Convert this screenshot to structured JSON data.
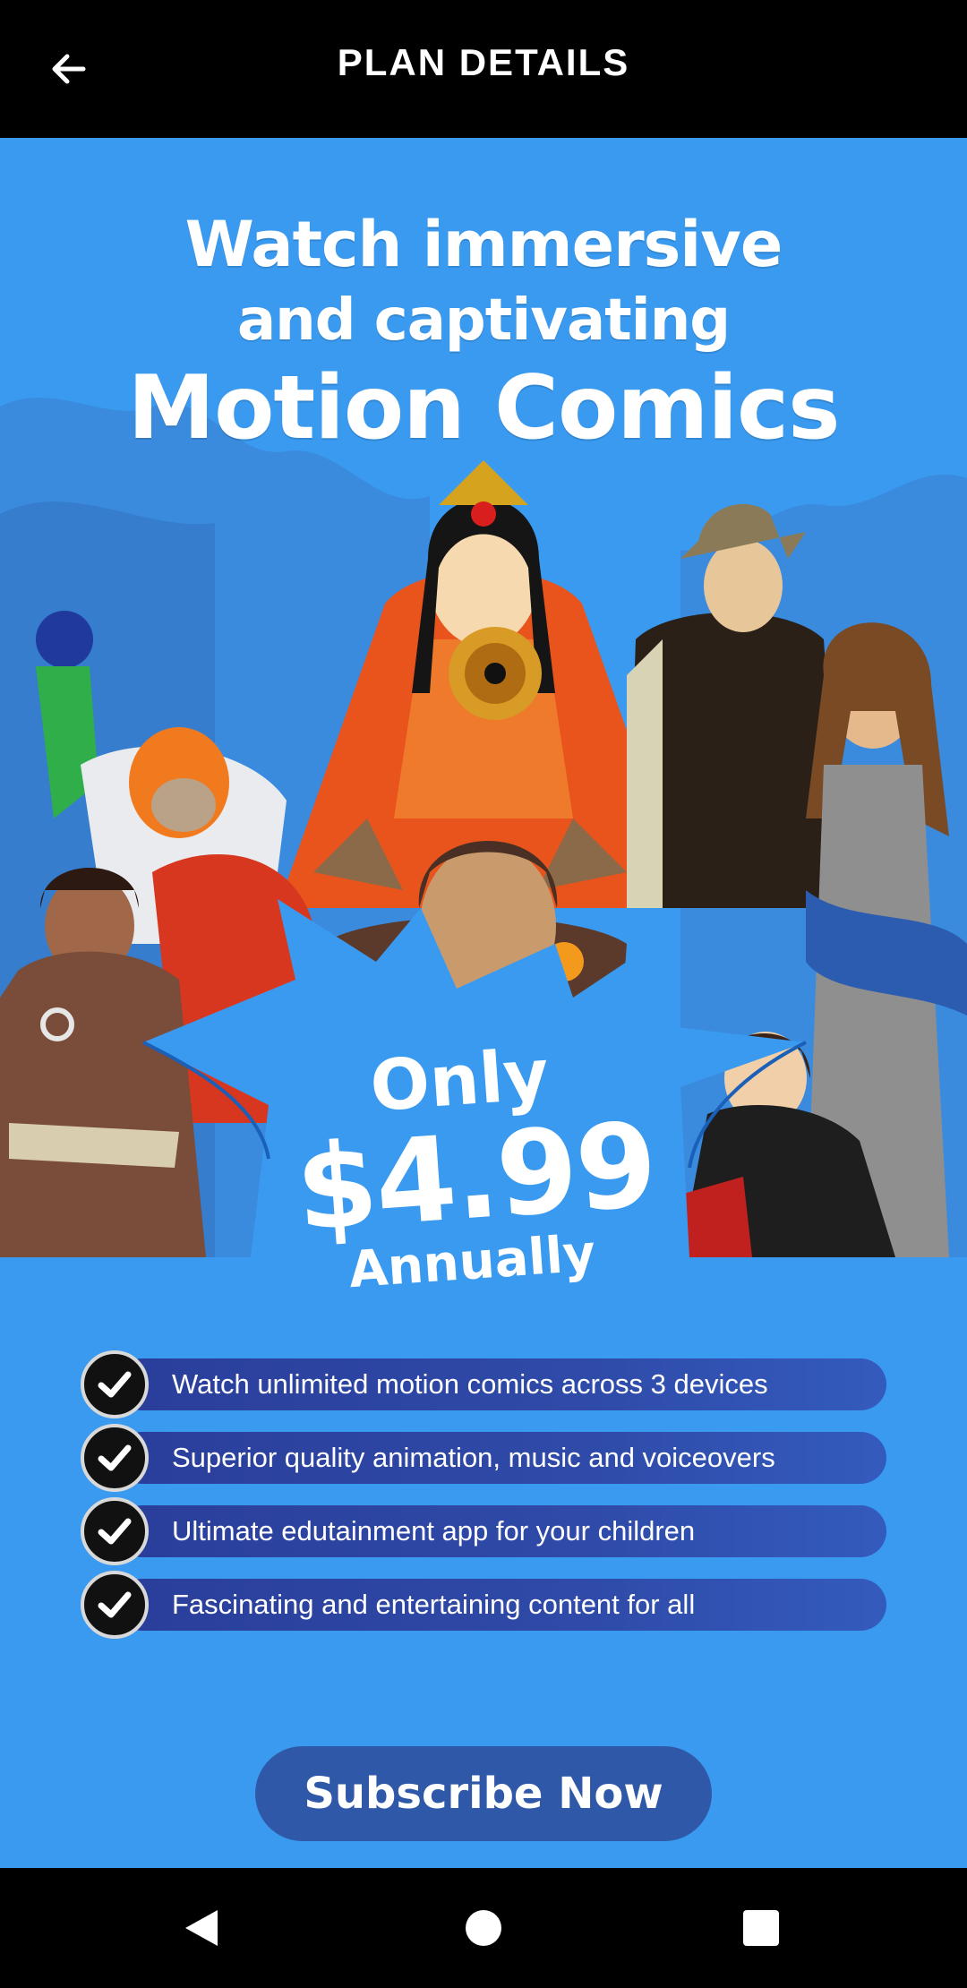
{
  "header": {
    "title": "PLAN DETAILS",
    "back_icon": "arrow-left-icon"
  },
  "hero": {
    "headline_line1": "Watch immersive",
    "headline_line2": "and captivating",
    "headline_line3": "Motion Comics",
    "price_prefix": "Only",
    "price_amount": "$4.99",
    "price_period": "Annually"
  },
  "features": [
    {
      "label": "Watch unlimited motion comics across 3 devices"
    },
    {
      "label": "Superior quality animation, music and voiceovers"
    },
    {
      "label": "Ultimate edutainment app for your children"
    },
    {
      "label": "Fascinating and entertaining content for all"
    }
  ],
  "cta": {
    "label": "Subscribe Now"
  },
  "navigation": {
    "back_icon": "nav-back-triangle-icon",
    "home_icon": "nav-home-circle-icon",
    "recents_icon": "nav-recents-square-icon"
  },
  "colors": {
    "background": "#3a9af0",
    "feature_bar": "#2f4aa8",
    "cta": "#2f59a8",
    "header": "#000000"
  }
}
